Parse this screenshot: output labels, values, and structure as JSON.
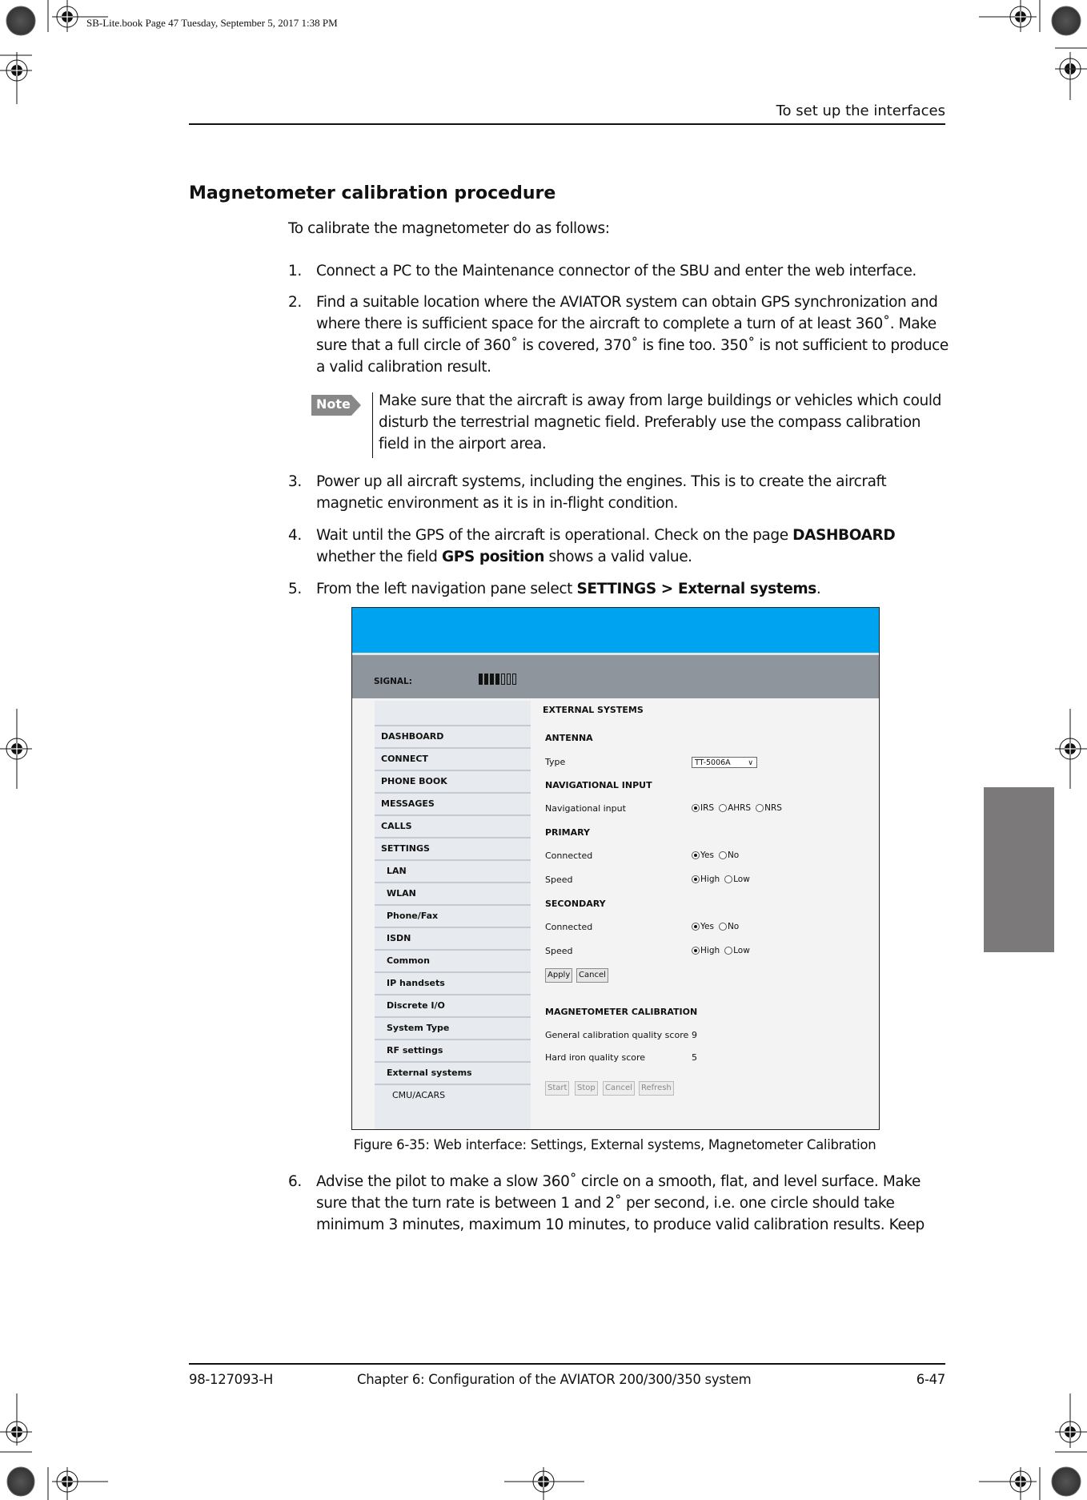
{
  "print_slug": "SB-Lite.book  Page 47  Tuesday, September 5, 2017  1:38 PM",
  "header": {
    "running_title": "To set up the interfaces"
  },
  "section": {
    "title": "Magnetometer calibration procedure",
    "intro": "To calibrate the magnetometer do as follows:"
  },
  "steps": [
    {
      "num": "1.",
      "text": "Connect a PC to the Maintenance connector of the SBU and enter the web interface."
    },
    {
      "num": "2.",
      "text": "Find a suitable location where the AVIATOR system can obtain GPS synchronization and where there is sufficient space for the aircraft to complete a turn of at least 360˚. Make sure that a full circle of 360˚ is covered, 370˚ is fine too. 350˚ is not sufficient to produce a valid calibration result."
    },
    {
      "num": "3.",
      "text": "Power up all aircraft systems, including the engines. This is to create the aircraft magnetic environment as it is in in-flight condition."
    },
    {
      "num": "4.",
      "text_a": "Wait until the GPS of the aircraft is operational. Check on the page ",
      "bold_a": "DASHBOARD",
      "text_b": " whether the field ",
      "bold_b": "GPS position",
      "text_c": " shows a valid value."
    },
    {
      "num": "5.",
      "text_a": "From the left navigation pane select ",
      "bold_a": "SETTINGS > External systems",
      "text_b": "."
    },
    {
      "num": "6.",
      "text": "Advise the pilot to make a slow 360˚ circle on a smooth, flat, and level surface. Make sure that the turn rate is between 1 and 2˚ per second, i.e. one circle should take minimum 3 minutes, maximum 10 minutes, to produce valid calibration results. Keep"
    }
  ],
  "note": {
    "badge": "Note",
    "text": "Make sure that the aircraft is away from large buildings or vehicles which could disturb the terrestrial magnetic field. Preferably use the compass calibration field in the airport area."
  },
  "screenshot": {
    "colors": {
      "topbar": "#00a3f0",
      "signalbar": "#8e959d",
      "nav_bg": "#e7eaee",
      "content_bg": "#f3f3f3"
    },
    "signal": {
      "label": "SIGNAL:",
      "level": 4,
      "max": 7
    },
    "nav": [
      {
        "label": "DASHBOARD",
        "level": 0
      },
      {
        "label": "CONNECT",
        "level": 0
      },
      {
        "label": "PHONE BOOK",
        "level": 0
      },
      {
        "label": "MESSAGES",
        "level": 0
      },
      {
        "label": "CALLS",
        "level": 0
      },
      {
        "label": "SETTINGS",
        "level": 0
      },
      {
        "label": "LAN",
        "level": 1
      },
      {
        "label": "WLAN",
        "level": 1
      },
      {
        "label": "Phone/Fax",
        "level": 1
      },
      {
        "label": "ISDN",
        "level": 1
      },
      {
        "label": "Common",
        "level": 1
      },
      {
        "label": "IP handsets",
        "level": 1
      },
      {
        "label": "Discrete I/O",
        "level": 1
      },
      {
        "label": "System Type",
        "level": 1
      },
      {
        "label": "RF settings",
        "level": 1
      },
      {
        "label": "External systems",
        "level": 1
      },
      {
        "label": "CMU/ACARS",
        "level": 2
      }
    ],
    "page_title": "EXTERNAL SYSTEMS",
    "antenna": {
      "heading": "ANTENNA",
      "type_label": "Type",
      "type_value": "TT-5006A"
    },
    "nav_input": {
      "heading": "NAVIGATIONAL INPUT",
      "label": "Navigational input",
      "options": [
        "IRS",
        "AHRS",
        "NRS"
      ],
      "selected": "IRS"
    },
    "primary": {
      "heading": "PRIMARY",
      "connected_label": "Connected",
      "connected_options": [
        "Yes",
        "No"
      ],
      "connected_selected": "Yes",
      "speed_label": "Speed",
      "speed_options": [
        "High",
        "Low"
      ],
      "speed_selected": "High"
    },
    "secondary": {
      "heading": "SECONDARY",
      "connected_label": "Connected",
      "connected_options": [
        "Yes",
        "No"
      ],
      "connected_selected": "Yes",
      "speed_label": "Speed",
      "speed_options": [
        "High",
        "Low"
      ],
      "speed_selected": "High"
    },
    "buttons": {
      "apply": "Apply",
      "cancel": "Cancel"
    },
    "magnetometer": {
      "heading": "MAGNETOMETER CALIBRATION",
      "general_label": "General calibration quality score",
      "general_value": "9",
      "hard_iron_label": "Hard iron quality score",
      "hard_iron_value": "5",
      "buttons": {
        "start": "Start",
        "stop": "Stop",
        "cancel": "Cancel",
        "refresh": "Refresh"
      }
    }
  },
  "caption": "Figure 6-35: Web interface: Settings, External systems, Magnetometer Calibration",
  "footer": {
    "doc_number": "98-127093-H",
    "chapter": "Chapter 6:  Configuration of the AVIATOR 200/300/350 system",
    "page": "6-47"
  }
}
